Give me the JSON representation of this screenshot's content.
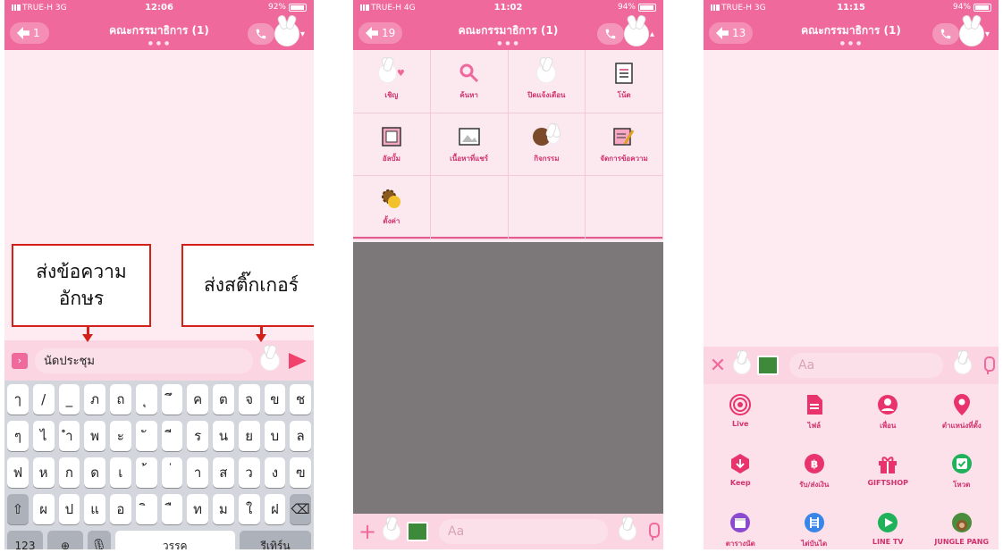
{
  "screens": [
    {
      "status": {
        "carrier": "TRUE-H",
        "network": "3G",
        "time": "12:06",
        "battery": "92%"
      },
      "header": {
        "back_count": "1",
        "title": "คณะกรรมาธิการ (1)"
      },
      "input": {
        "text": "นัดประชุม"
      },
      "keyboard": {
        "row1": [
          "ๅ",
          "/",
          "_",
          "ภ",
          "ถ",
          "ุ",
          "ึ",
          "ค",
          "ต",
          "จ",
          "ข",
          "ช"
        ],
        "row2": [
          "ๆ",
          "ไ",
          "ำ",
          "พ",
          "ะ",
          "ั",
          "ี",
          "ร",
          "น",
          "ย",
          "บ",
          "ล"
        ],
        "row3": [
          "ฟ",
          "ห",
          "ก",
          "ด",
          "เ",
          "้",
          "่",
          "า",
          "ส",
          "ว",
          "ง",
          "ฃ"
        ],
        "row4": [
          "ผ",
          "ป",
          "แ",
          "อ",
          "ิ",
          "ื",
          "ท",
          "ม",
          "ใ",
          "ฝ"
        ],
        "num_label": "123",
        "space_label": "วรรค",
        "return_label": "รีเทิร์น"
      },
      "callouts": {
        "text_msg": "ส่งข้อความ\nอักษร",
        "sticker": "ส่งสติ๊กเกอร์"
      }
    },
    {
      "status": {
        "carrier": "TRUE-H",
        "network": "4G",
        "time": "11:02",
        "battery": "94%"
      },
      "header": {
        "back_count": "19",
        "title": "คณะกรรมาธิการ (1)"
      },
      "grid": [
        {
          "label": "เชิญ",
          "icon": "invite-icon"
        },
        {
          "label": "ค้นหา",
          "icon": "search-icon"
        },
        {
          "label": "ปิดแจ้งเตือน",
          "icon": "mute-icon"
        },
        {
          "label": "โน้ต",
          "icon": "note-icon"
        },
        {
          "label": "อัลบั้ม",
          "icon": "album-icon"
        },
        {
          "label": "เนื้อหาที่แชร์",
          "icon": "shared-media-icon"
        },
        {
          "label": "กิจกรรม",
          "icon": "events-icon"
        },
        {
          "label": "จัดการข้อความ",
          "icon": "manage-messages-icon"
        },
        {
          "label": "ตั้งค่า",
          "icon": "settings-icon"
        }
      ],
      "input": {
        "placeholder": "Aa"
      }
    },
    {
      "status": {
        "carrier": "TRUE-H",
        "network": "3G",
        "time": "11:15",
        "battery": "94%"
      },
      "header": {
        "back_count": "13",
        "title": "คณะกรรมาธิการ (1)"
      },
      "input": {
        "placeholder": "Aa"
      },
      "menu": [
        {
          "label": "Live",
          "icon": "live-icon",
          "color": "#e8336d"
        },
        {
          "label": "ไฟล์",
          "icon": "file-icon",
          "color": "#e8336d"
        },
        {
          "label": "เพื่อน",
          "icon": "friend-icon",
          "color": "#e8336d"
        },
        {
          "label": "ตำแหน่งที่ตั้ง",
          "icon": "location-icon",
          "color": "#e8336d"
        },
        {
          "label": "Keep",
          "icon": "keep-icon",
          "color": "#e8336d"
        },
        {
          "label": "รับ/ส่งเงิน",
          "icon": "pay-icon",
          "color": "#e8336d"
        },
        {
          "label": "GIFTSHOP",
          "icon": "gift-icon",
          "color": "#e8336d"
        },
        {
          "label": "โหวต",
          "icon": "vote-icon",
          "color": "#1fb25a"
        },
        {
          "label": "ตารางนัด",
          "icon": "schedule-icon",
          "color": "#8b4bd0"
        },
        {
          "label": "ไต่บันได",
          "icon": "ladder-icon",
          "color": "#3a86e8"
        },
        {
          "label": "LINE TV",
          "icon": "line-tv-icon",
          "color": "#1fb25a"
        },
        {
          "label": "JUNGLE PANG",
          "icon": "jungle-pang-icon",
          "color": "#4a8d3c"
        }
      ]
    }
  ],
  "colors": {
    "brand_pink": "#f0699c",
    "send_red": "#f0426c",
    "callout_red": "#d3201a",
    "overlay_gray": "#7c7879"
  }
}
